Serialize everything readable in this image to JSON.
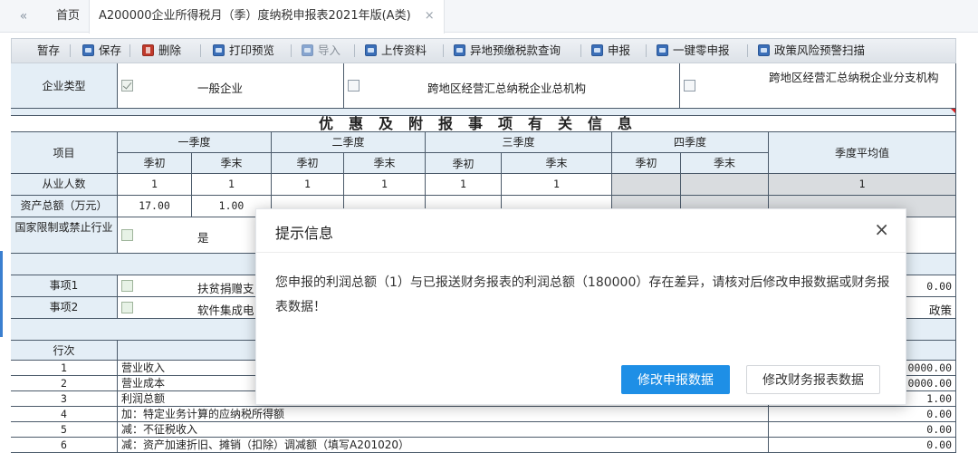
{
  "tabs": {
    "collapse_icon": "«",
    "home": "首页",
    "active": "A200000企业所得税月（季）度纳税申报表2021年版(A类)",
    "close": "×"
  },
  "toolbar": {
    "save_temp": "暂存",
    "save": "保存",
    "delete": "删除",
    "print_preview": "打印预览",
    "import": "导入",
    "upload": "上传资料",
    "prepaid_query": "异地预缴税款查询",
    "declare": "申报",
    "zero_declare": "一键零申报",
    "risk_scan": "政策风险预警扫描"
  },
  "form": {
    "enterprise_type_label": "企业类型",
    "opt_general": "一般企业",
    "opt_head": "跨地区经营汇总纳税企业总机构",
    "opt_branch": "跨地区经营汇总纳税企业分支机构",
    "section_title": "优惠及附报事项有关信息",
    "col_item": "项目",
    "q1": "一季度",
    "q2": "二季度",
    "q3": "三季度",
    "q4": "四季度",
    "avg": "季度平均值",
    "begin": "季初",
    "end": "季末",
    "row_employees": "从业人数",
    "employees": {
      "q1b": "1",
      "q1e": "1",
      "q2b": "1",
      "q2e": "1",
      "q3b": "1",
      "q3e": "1",
      "avg": "1"
    },
    "row_assets": "资产总额（万元）",
    "assets": {
      "q1b": "17.00",
      "q1e": "1.00"
    },
    "row_restricted": "国家限制或禁止行业",
    "restricted_yes": "是",
    "item1_label": "事项1",
    "item1_text": "扶贫捐赠支",
    "item1_value": "0.00",
    "item2_label": "事项2",
    "item2_text": "软件集成电",
    "item2_right": "政策",
    "row_no_header": "行次",
    "rows": [
      {
        "no": "1",
        "name": "营业收入",
        "value": "0000.00"
      },
      {
        "no": "2",
        "name": "营业成本",
        "value": "0000.00"
      },
      {
        "no": "3",
        "name": "利润总额",
        "value": "1.00"
      },
      {
        "no": "4",
        "name": "加：特定业务计算的应纳税所得额",
        "value": "0.00"
      },
      {
        "no": "5",
        "name": "减：不征税收入",
        "value": "0.00"
      },
      {
        "no": "6",
        "name": "减：资产加速折旧、摊销（扣除）调减额（填写A201020）",
        "value": "0.00"
      }
    ]
  },
  "dialog": {
    "title": "提示信息",
    "close": "×",
    "message": "您申报的利润总额（1）与已报送财务报表的利润总额（180000）存在差异，请核对后修改申报数据或财务报表数据！",
    "btn_primary": "修改申报数据",
    "btn_secondary": "修改财务报表数据"
  }
}
